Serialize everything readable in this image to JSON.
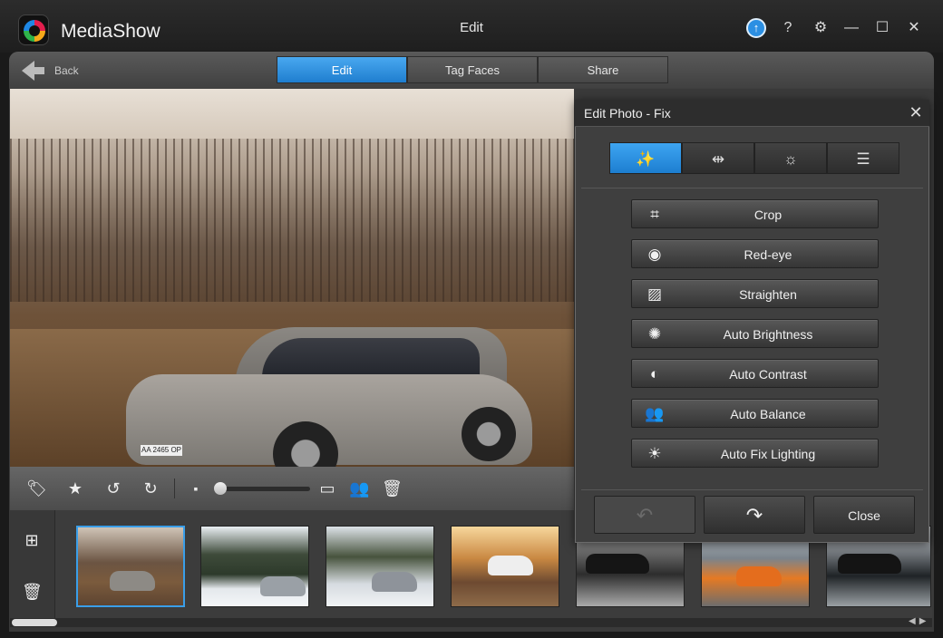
{
  "app": {
    "name": "MediaShow",
    "window_title": "Edit"
  },
  "titlebar": {
    "update_icon": "upload-arrow-icon",
    "help_label": "?",
    "settings_icon": "gear-icon",
    "minimize_label": "—",
    "maximize_label": "☐",
    "close_label": "✕"
  },
  "nav": {
    "back_label": "Back",
    "tabs": [
      {
        "label": "Edit",
        "active": true
      },
      {
        "label": "Tag Faces",
        "active": false
      },
      {
        "label": "Share",
        "active": false
      }
    ]
  },
  "photo": {
    "plate_text": "AA 2465 OP"
  },
  "toolbar": {
    "icons": [
      "tag-icon",
      "star-icon",
      "rotate-left-icon",
      "rotate-right-icon",
      "small-thumb-icon",
      "large-view-icon",
      "people-icon",
      "trash-icon"
    ],
    "zoom_level": 0
  },
  "dialog": {
    "title": "Edit Photo - Fix",
    "close_label": "✕",
    "mode_tabs": [
      {
        "name": "fix-wand-icon",
        "glyph": "✨",
        "active": true
      },
      {
        "name": "adjust-icon",
        "glyph": "⇹",
        "active": false
      },
      {
        "name": "effects-icon",
        "glyph": "☼",
        "active": false
      },
      {
        "name": "checklist-icon",
        "glyph": "☰",
        "active": false
      }
    ],
    "buttons": [
      {
        "label": "Crop",
        "icon": "crop-icon",
        "glyph": "⌗"
      },
      {
        "label": "Red-eye",
        "icon": "eye-icon",
        "glyph": "◉"
      },
      {
        "label": "Straighten",
        "icon": "straighten-icon",
        "glyph": "▨"
      },
      {
        "label": "Auto Brightness",
        "icon": "sun-icon",
        "glyph": "✺"
      },
      {
        "label": "Auto Contrast",
        "icon": "contrast-icon",
        "glyph": "◐"
      },
      {
        "label": "Auto Balance",
        "icon": "balance-icon",
        "glyph": "👥"
      },
      {
        "label": "Auto Fix Lighting",
        "icon": "lighting-icon",
        "glyph": "☀"
      }
    ],
    "undo_label": "↶",
    "redo_label": "↷",
    "close_button_label": "Close"
  },
  "filmstrip": {
    "add_icon": "add-photo-icon",
    "delete_icon": "trash-icon",
    "selected_index": 0,
    "thumb_count": 7
  },
  "colors": {
    "accent": "#2a8fe0",
    "background": "#3a3a3a",
    "dialog": "#3f3f3f"
  }
}
